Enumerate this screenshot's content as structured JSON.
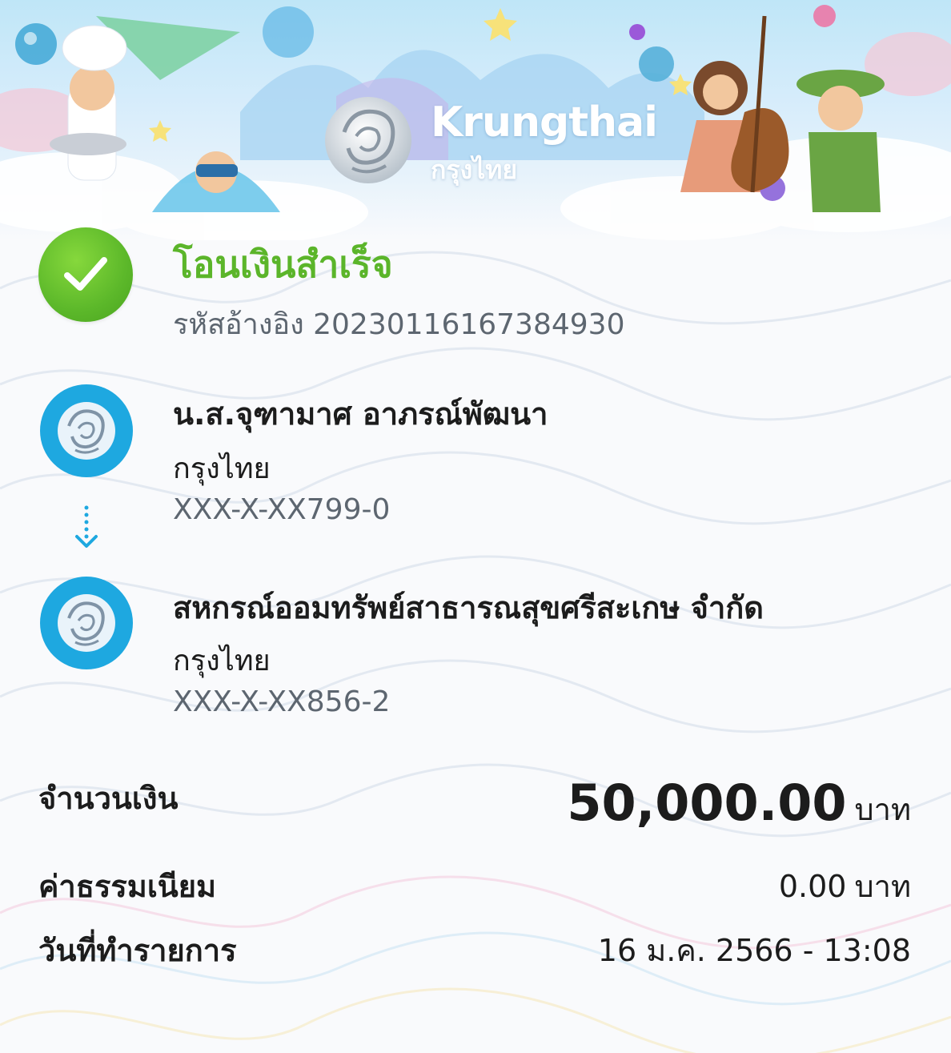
{
  "brand": {
    "name": "Krungthai",
    "name_thai": "กรุงไทย"
  },
  "status": {
    "title": "โอนเงินสำเร็จ",
    "ref_label": "รหัสอ้างอิง",
    "ref_number": "2023011616738493​0"
  },
  "sender": {
    "name": "น.ส.จุฑามาศ อาภรณ์พัฒนา",
    "bank": "กรุงไทย",
    "account": "XXX-X-XX799-0"
  },
  "receiver": {
    "name": "สหกรณ์ออมทรัพย์สาธารณสุขศรีสะเกษ จำกัด",
    "bank": "กรุงไทย",
    "account": "XXX-X-XX856-2"
  },
  "summary": {
    "amount_label": "จำนวนเงิน",
    "amount_value": "50,000.00",
    "amount_unit": "บาท",
    "fee_label": "ค่าธรรมเนียม",
    "fee_value": "0.00",
    "fee_unit": "บาท",
    "date_label": "วันที่ทำรายการ",
    "date_value": "16 ม.ค. 2566 - 13:08"
  },
  "colors": {
    "success": "#5bb52a",
    "bank_blue": "#1ea8e0",
    "muted": "#5d6670"
  },
  "icons": {
    "status": "check-icon",
    "bank": "krungthai-logo-icon",
    "flow": "arrow-down-icon"
  }
}
